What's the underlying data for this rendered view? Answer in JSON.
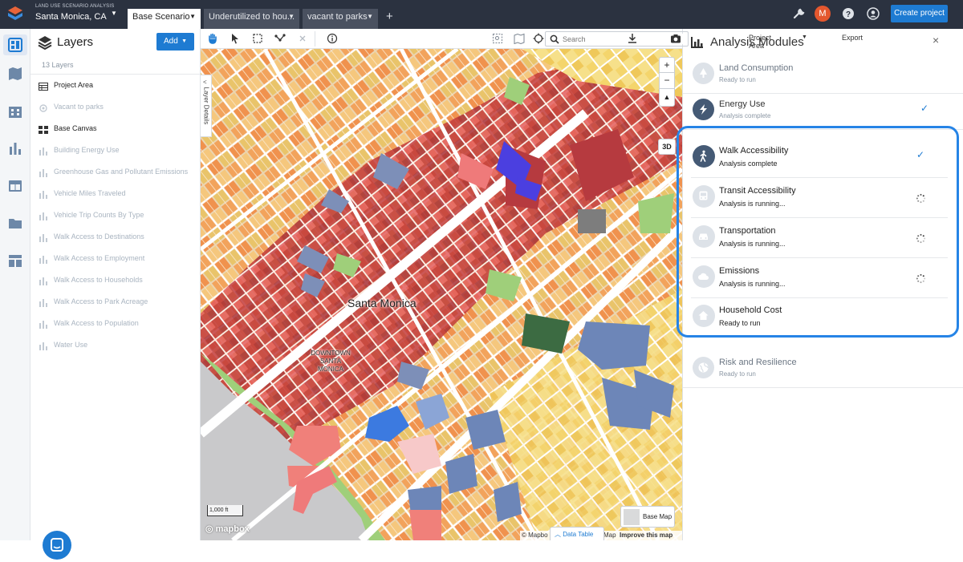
{
  "app": {
    "subtitle": "LAND USE SCENARIO ANALYSIS",
    "project_name": "Santa Monica, CA",
    "tabs": [
      {
        "label": "Base Scenario",
        "active": true
      },
      {
        "label": "Underutilized to hou...",
        "active": false
      },
      {
        "label": "vacant to parks",
        "active": false
      }
    ],
    "add_tab": "+",
    "avatar_initial": "M",
    "create_project": "Create project",
    "accent_color": "#1e7bd2",
    "topbar_color": "#2b3240"
  },
  "rail_icons": [
    "dashboard-icon",
    "map-icon",
    "buildings-icon",
    "bar-chart-icon",
    "table-icon",
    "folder-icon",
    "layout-icon"
  ],
  "layers": {
    "title": "Layers",
    "add_label": "Add",
    "count": "13 Layers",
    "items": [
      {
        "label": "Project Area",
        "icon": "table-grid-icon",
        "enabled": true
      },
      {
        "label": "Vacant to parks",
        "icon": "ring-icon",
        "enabled": false
      },
      {
        "label": "Base Canvas",
        "icon": "grid-icon",
        "enabled": true
      },
      {
        "label": "Building Energy Use",
        "icon": "bar-chart-icon",
        "enabled": false
      },
      {
        "label": "Greenhouse Gas and Pollutant Emissions",
        "icon": "bar-chart-icon",
        "enabled": false
      },
      {
        "label": "Vehicle Miles Traveled",
        "icon": "bar-chart-icon",
        "enabled": false
      },
      {
        "label": "Vehicle Trip Counts By Type",
        "icon": "bar-chart-icon",
        "enabled": false
      },
      {
        "label": "Walk Access to Destinations",
        "icon": "bar-chart-icon",
        "enabled": false
      },
      {
        "label": "Walk Access to Employment",
        "icon": "bar-chart-icon",
        "enabled": false
      },
      {
        "label": "Walk Access to Households",
        "icon": "bar-chart-icon",
        "enabled": false
      },
      {
        "label": "Walk Access to Park Acreage",
        "icon": "bar-chart-icon",
        "enabled": false
      },
      {
        "label": "Walk Access to Population",
        "icon": "bar-chart-icon",
        "enabled": false
      },
      {
        "label": "Water Use",
        "icon": "bar-chart-icon",
        "enabled": false
      }
    ]
  },
  "toolbar": {
    "search_placeholder": "Search",
    "project_area": "Project Area",
    "export": "Export"
  },
  "map": {
    "layer_details": "Layer Details",
    "city_label": "Santa Monica",
    "district_label": [
      "DOWNTOWN",
      "SANTA",
      "MONICA"
    ],
    "zoom_in": "+",
    "zoom_out": "−",
    "compass": "▲",
    "three_d": "3D",
    "scale": "1,000 ft",
    "mapbox_logo": "mapbox",
    "base_map": "Base Map",
    "attribution": "© Mapbo",
    "attribution_b": "Map",
    "improve": "Improve this map",
    "data_table": "Data Table"
  },
  "panel": {
    "title": "Analysis Modules",
    "close": "×",
    "modules": [
      {
        "name": "Land Consumption",
        "status": "Ready to run",
        "icon": "tree-icon",
        "state": "idle"
      },
      {
        "name": "Energy Use",
        "status": "Analysis complete",
        "icon": "bolt-icon",
        "state": "done"
      },
      {
        "name": "Walk Accessibility",
        "status": "Analysis complete",
        "icon": "walk-icon",
        "state": "done"
      },
      {
        "name": "Transit Accessibility",
        "status": "Analysis is running...",
        "icon": "bus-icon",
        "state": "running"
      },
      {
        "name": "Transportation",
        "status": "Analysis is running...",
        "icon": "car-icon",
        "state": "running"
      },
      {
        "name": "Emissions",
        "status": "Analysis is running...",
        "icon": "cloud-icon",
        "state": "running"
      },
      {
        "name": "Household Cost",
        "status": "Ready to run",
        "icon": "home-icon",
        "state": "idle"
      },
      {
        "name": "Risk and Resilience",
        "status": "Ready to run",
        "icon": "globe-icon",
        "state": "idle"
      }
    ],
    "checkmark": "✓",
    "highlight_color": "#2684e6"
  }
}
